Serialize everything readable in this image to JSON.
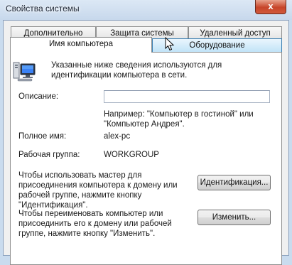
{
  "window": {
    "title": "Свойства системы",
    "close_glyph": "x"
  },
  "tabs": {
    "advanced": "Дополнительно",
    "protection": "Защита системы",
    "remote": "Удаленный доступ",
    "computer_name": "Имя компьютера",
    "hardware": "Оборудование"
  },
  "page": {
    "intro": "Указанные ниже сведения используются для идентификации компьютера в сети.",
    "description_label": "Описание:",
    "description_value": "",
    "example": "Например: \"Компьютер в гостиной\" или \"Компьютер Андрея\".",
    "fullname_label": "Полное имя:",
    "fullname_value": "alex-pc",
    "workgroup_label": "Рабочая группа:",
    "workgroup_value": "WORKGROUP",
    "wizard_text": "Чтобы использовать мастер для присоединения компьютера к домену или рабочей группе, нажмите кнопку \"Идентификация\".",
    "id_button": "Идентификация...",
    "rename_text": "Чтобы переименовать компьютер или присоединить его к домену или рабочей группе, нажмите кнопку \"Изменить\".",
    "change_button": "Изменить..."
  },
  "icons": {
    "computer": "computer-icon",
    "cursor": "mouse-cursor-icon",
    "close": "close-icon"
  }
}
